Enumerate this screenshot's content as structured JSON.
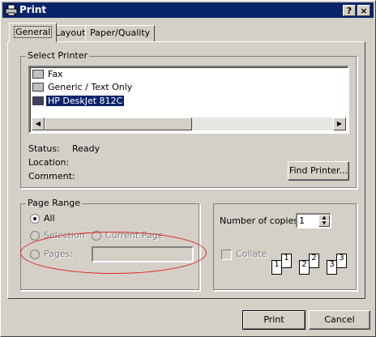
{
  "window": {
    "title": "Print",
    "help_label": "?",
    "close_label": "×"
  },
  "tabs": [
    {
      "label": "General"
    },
    {
      "label": "Layout"
    },
    {
      "label": "Paper/Quality"
    }
  ],
  "select_printer": {
    "label": "Select Printer",
    "printers": [
      {
        "name": "Fax"
      },
      {
        "name": "Generic / Text Only"
      },
      {
        "name": "HP DeskJet 812C"
      }
    ],
    "status_label": "Status:",
    "status_value": "Ready",
    "location_label": "Location:",
    "comment_label": "Comment:",
    "find_printer_label": "Find Printer..."
  },
  "page_range": {
    "label": "Page Range",
    "all_label": "All",
    "selection_label": "Selection",
    "current_page_label": "Current Page",
    "pages_label": "Pages:"
  },
  "copies": {
    "number_label": "Number of copies:",
    "value": "1",
    "collate_label": "Collate",
    "page_icons": [
      "1",
      "1",
      "2",
      "2",
      "3",
      "3"
    ]
  },
  "buttons": {
    "print_label": "Print",
    "cancel_label": "Cancel"
  },
  "colors": {
    "title_bar": "#0a246a",
    "dialog_bg": "#d4d0c8",
    "annotation": "#dd2222"
  }
}
